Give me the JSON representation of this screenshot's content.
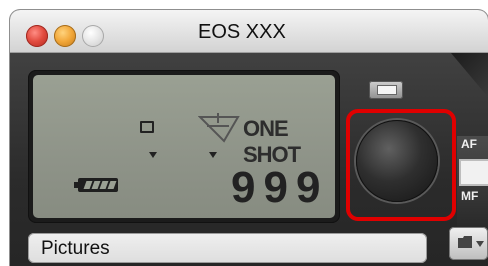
{
  "window": {
    "title": "EOS XXX"
  },
  "lcd": {
    "drive_mode_icon": "single-shot-icon",
    "metering_icon": "evaluative-metering-icon",
    "af_mode": "ONE SHOT",
    "shots_remaining": "999",
    "battery_icon": "battery-full-icon"
  },
  "controls": {
    "shutter_button": "shutter-button",
    "af_label": "AF",
    "mf_label": "MF",
    "folder_icon": "folder-icon"
  },
  "save_folder": {
    "value": "Pictures"
  },
  "colors": {
    "highlight": "#e00000",
    "lcd_bg": "#8e9388",
    "body_dark": "#2b2b2b"
  }
}
